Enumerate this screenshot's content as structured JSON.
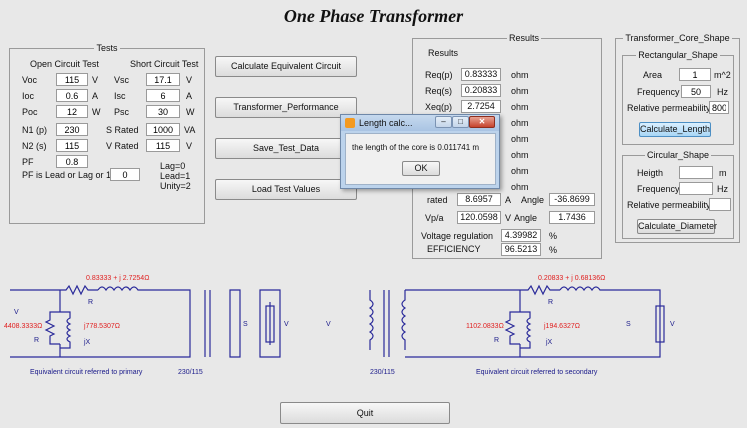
{
  "title": "One Phase Transformer",
  "tests": {
    "group_title": "Tests",
    "open_heading": "Open Circuit Test",
    "short_heading": "Short Circuit Test",
    "voc_label": "Voc",
    "voc": "115",
    "voc_unit": "V",
    "ioc_label": "Ioc",
    "ioc": "0.6",
    "ioc_unit": "A",
    "poc_label": "Poc",
    "poc": "12",
    "poc_unit": "W",
    "n1_label": "N1 (p)",
    "n1": "230",
    "n2_label": "N2 (s)",
    "n2": "115",
    "pf_label": "PF",
    "pf": "0.8",
    "vsc_label": "Vsc",
    "vsc": "17.1",
    "vsc_unit": "V",
    "isc_label": "Isc",
    "isc": "6",
    "isc_unit": "A",
    "psc_label": "Psc",
    "psc": "30",
    "psc_unit": "W",
    "srated_label": "S Rated",
    "srated": "1000",
    "srated_unit": "VA",
    "vrated_label": "V Rated",
    "vrated": "115",
    "vrated_unit": "V",
    "pf_type_label": "PF is Lead or Lag or 1",
    "pf_type": "0",
    "hint_lag": "Lag=0",
    "hint_lead": "Lead=1",
    "hint_unity": "Unity=2"
  },
  "buttons": {
    "calc_equiv": "Calculate Equivalent Circuit",
    "performance": "Transformer_Performance",
    "save_test": "Save_Test_Data",
    "load_test": "Load Test Values",
    "quit": "Quit"
  },
  "results": {
    "group_title": "Results",
    "heading": "Results",
    "reqp_label": "Req(p)",
    "reqp": "0.83333",
    "reqp_unit": "ohm",
    "reqs_label": "Req(s)",
    "reqs": "0.20833",
    "reqs_unit": "ohm",
    "xeqp_label": "Xeq(p)",
    "xeqp": "2.7254",
    "xeqp_unit": "ohm",
    "ohm": "ohm",
    "irated_partial": "rated",
    "irated": "8.6957",
    "irated_unit": "A",
    "angle_label": "Angle",
    "angle1": "-36.8699",
    "vpa_label": "Vp/a",
    "vpa": "120.0598",
    "vpa_unit": "V",
    "angle2": "1.7436",
    "vreg_label": "Voltage regulation",
    "vreg": "4.39982",
    "pct": "%",
    "eff_label": "EFFICIENCY",
    "eff": "96.5213"
  },
  "core": {
    "group_title": "Transformer_Core_Shape",
    "rect_title": "Rectangular_Shape",
    "area_label": "Area",
    "area": "1",
    "area_unit": "m^2",
    "freq_label": "Frequency",
    "freq": "50",
    "freq_unit": "Hz",
    "perm_label": "Relative permeability",
    "perm": "800",
    "calc_length": "Calculate_Length",
    "circ_title": "Circular_Shape",
    "height_label": "Heigth",
    "height_unit": "m",
    "cfreq_label": "Frequency",
    "cfreq_unit": "Hz",
    "cperm_label": "Relative permeability",
    "calc_diameter": "Calculate_Diameter"
  },
  "dialog": {
    "title": "Length calc...",
    "message": "the length of the core is 0.011741 m",
    "ok": "OK"
  },
  "circuit": {
    "z1": "0.83333 + j 2.7254Ω",
    "r1x1": "R",
    "v1": "V",
    "rc1": "4408.3333Ω",
    "xm1": "j778.5307Ω",
    "r01": "R",
    "jx01": "jX",
    "sload": "S",
    "v2": "V",
    "caption1": "Equivalent circuit referred to primary",
    "ratio1": "230/115",
    "ratio2": "230/115",
    "z2": "0.20833 + j 0.68136Ω",
    "rc2": "1102.0833Ω",
    "xm2": "j194.6327Ω",
    "caption2": "Equivalent circuit referred to secondary"
  }
}
